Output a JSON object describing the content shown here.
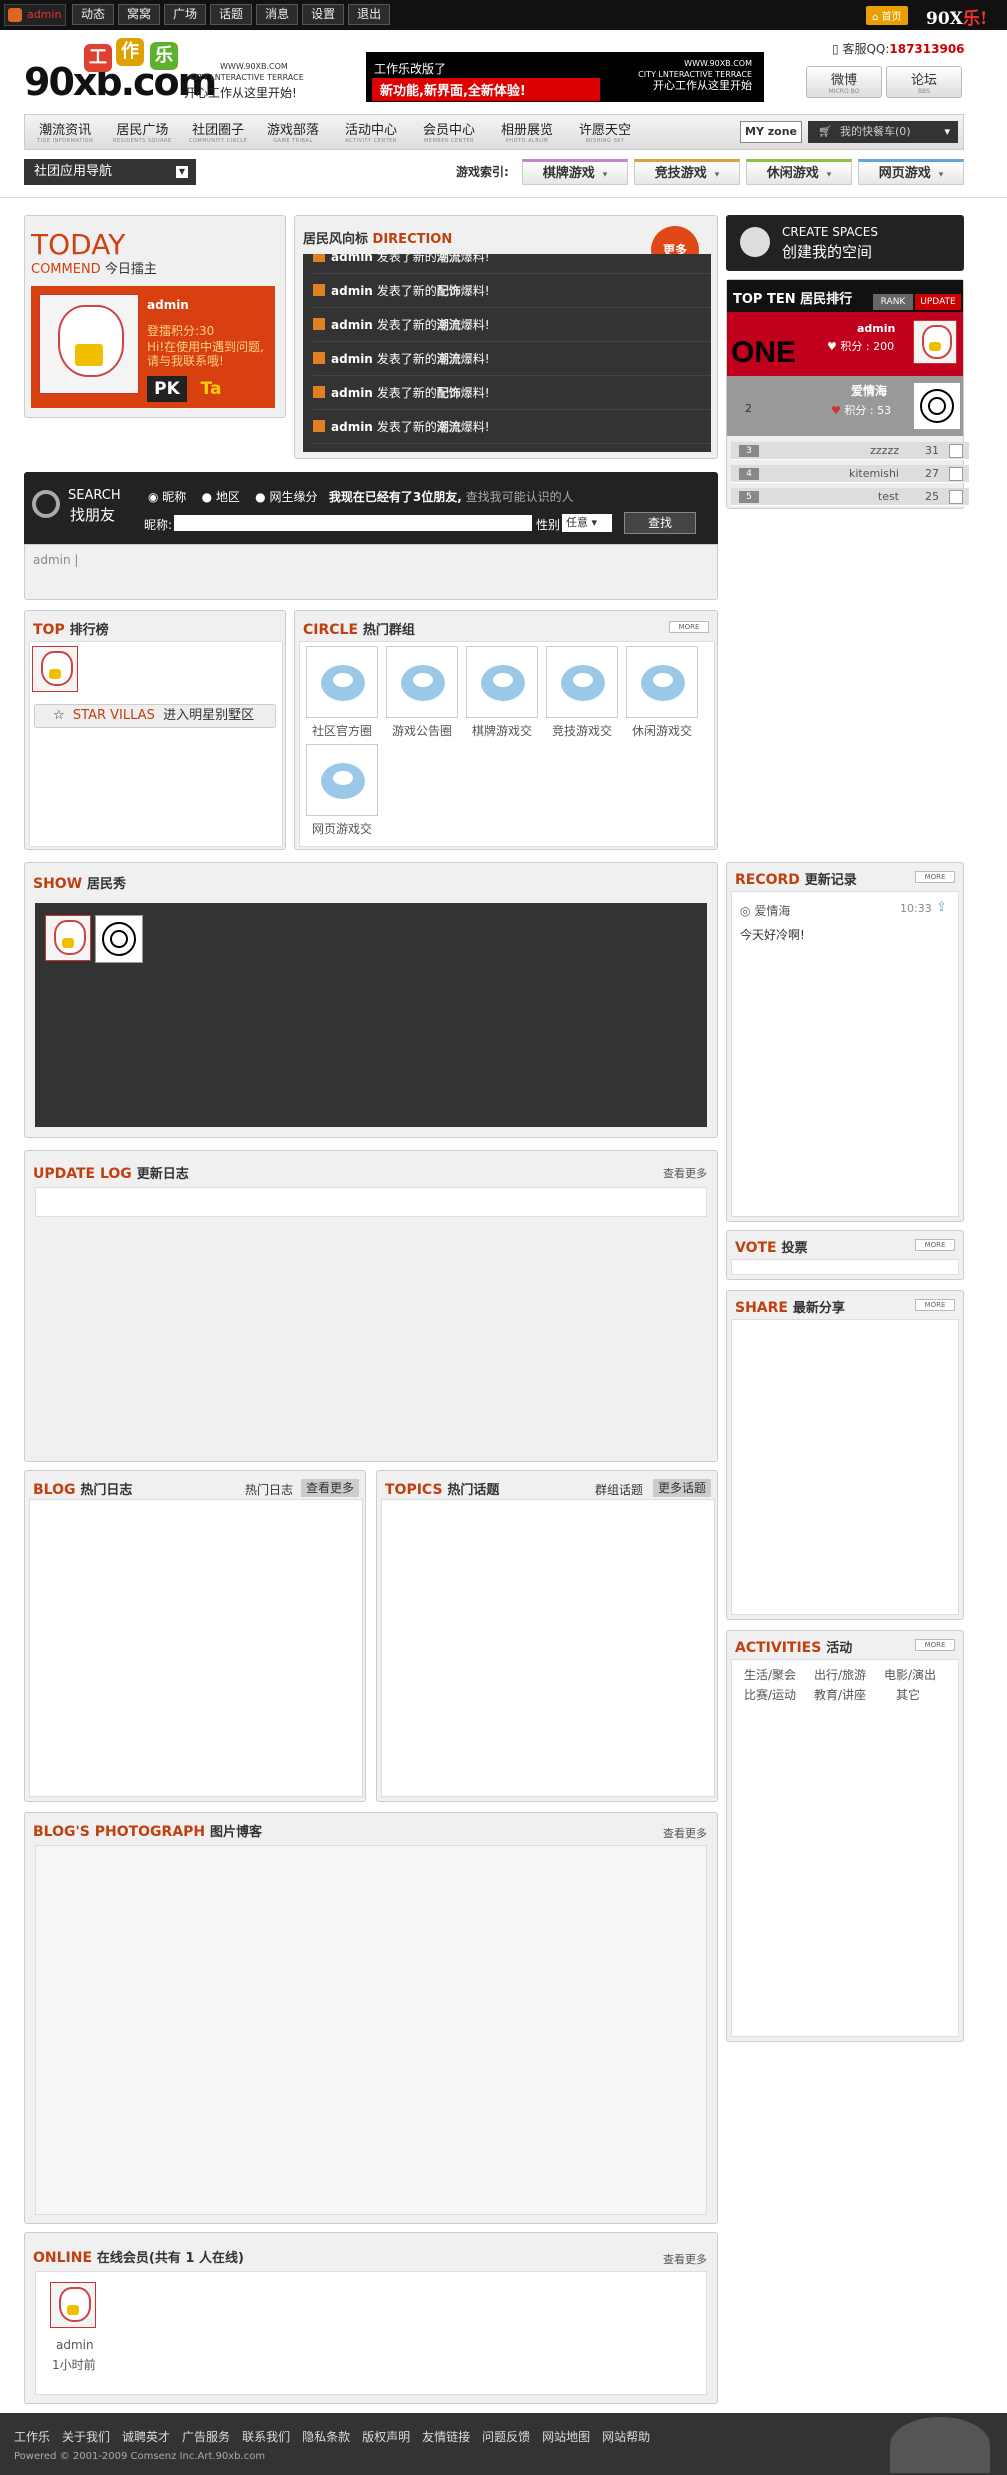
{
  "topbar": {
    "user": "admin",
    "nav": [
      "动态",
      "窝窝",
      "广场",
      "话题",
      "消息",
      "设置",
      "退出"
    ],
    "home_label": "首页",
    "brand": "90X",
    "brand_suffix": "乐!"
  },
  "header": {
    "logo_text": "90xb.com",
    "logo_chars": [
      "工",
      "作",
      "乐"
    ],
    "site_url": "WWW.90XB.COM",
    "slogan_en": "CITY LNTERACTIVE TERRACE",
    "slogan_cn": "开心工作从这里开始!",
    "banner_top": "工作乐改版了",
    "banner_main": "新功能,新界面,全新体验!",
    "banner_url": "WWW.90XB.COM",
    "banner_en": "CITY LNTERACTIVE TERRACE",
    "banner_cn": "开心工作从这里开始",
    "qq_label": "客服QQ:",
    "qq_number": "187313906",
    "btn_micro": "微博",
    "btn_micro_sub": "MICRO BO",
    "btn_bbs": "论坛",
    "btn_bbs_sub": "BBS"
  },
  "mainnav": {
    "items": [
      {
        "label": "潮流资讯",
        "sub": "TIDE INFORMATION"
      },
      {
        "label": "居民广场",
        "sub": "RESIDENTS SQUARE"
      },
      {
        "label": "社团圈子",
        "sub": "COMMUNITY CIRCLE"
      },
      {
        "label": "游戏部落",
        "sub": "GAME TRIBAL"
      },
      {
        "label": "活动中心",
        "sub": "ACTIVITY CENTER"
      },
      {
        "label": "会员中心",
        "sub": "MEMBER CENTER"
      },
      {
        "label": "相册展览",
        "sub": "PHOTO ALBUM"
      },
      {
        "label": "许愿天空",
        "sub": "WISHING SKY"
      }
    ],
    "myzone": "MY zone",
    "cart": "我的快餐车(0)"
  },
  "subnav": {
    "app_nav": "社团应用导航",
    "game_index": "游戏索引:",
    "games": [
      "棋牌游戏",
      "竞技游戏",
      "休闲游戏",
      "网页游戏"
    ]
  },
  "today": {
    "title_en": "TODAY",
    "sub_en": "COMMEND",
    "sub_cn": "今日擂主",
    "user": "admin",
    "points": "登擂积分:30",
    "msg1": "Hi!在使用中遇到问题,",
    "msg2": "请与我联系哦!",
    "pk": "PK",
    "ta": "Ta"
  },
  "direction": {
    "title_cn": "居民风向标",
    "title_en": "DIRECTION",
    "more": "更多",
    "rows": [
      {
        "user": "admin",
        "text": "发表了新的",
        "tag": "潮流",
        "suffix": "爆料!"
      },
      {
        "user": "admin",
        "text": "发表了新的",
        "tag": "配饰",
        "suffix": "爆料!"
      },
      {
        "user": "admin",
        "text": "发表了新的",
        "tag": "潮流",
        "suffix": "爆料!"
      },
      {
        "user": "admin",
        "text": "发表了新的",
        "tag": "潮流",
        "suffix": "爆料!"
      },
      {
        "user": "admin",
        "text": "发表了新的",
        "tag": "配饰",
        "suffix": "爆料!"
      },
      {
        "user": "admin",
        "text": "发表了新的",
        "tag": "潮流",
        "suffix": "爆料!"
      }
    ]
  },
  "create_space": {
    "en": "CREATE SPACES",
    "cn": "创建我的空间"
  },
  "topten": {
    "title": "TOP TEN 居民排行",
    "tab_rank": "RANK",
    "tab_update": "UPDATE",
    "one": "ONE",
    "first_name": "admin",
    "first_score": "积分 : 200",
    "second_num": "2",
    "second_name": "爱情海",
    "second_score": "积分 : 53",
    "rows": [
      {
        "n": "3",
        "name": "zzzzz",
        "score": "31"
      },
      {
        "n": "4",
        "name": "kitemishi",
        "score": "27"
      },
      {
        "n": "5",
        "name": "test",
        "score": "25"
      }
    ]
  },
  "search": {
    "en": "SEARCH",
    "cn": "找朋友",
    "opt1": "昵称",
    "opt2": "地区",
    "opt3": "网生缘分",
    "info": "我现在已经有了3位朋友,",
    "info2": "查找我可能认识的人",
    "name_label": "昵称:",
    "sex_label": "性别",
    "sex_value": "任意",
    "btn": "查找",
    "footer": "admin |"
  },
  "top_rank": {
    "en": "TOP",
    "cn": "排行榜",
    "star": "STAR VILLAS",
    "star_cn": "进入明星别墅区"
  },
  "circle": {
    "en": "CIRCLE",
    "cn": "热门群组",
    "more": "MORE",
    "groups": [
      "社区官方圈",
      "游戏公告圈",
      "棋牌游戏交",
      "竞技游戏交",
      "休闲游戏交",
      "网页游戏交"
    ]
  },
  "show": {
    "en": "SHOW",
    "cn": "居民秀"
  },
  "record": {
    "en": "RECORD",
    "cn": "更新记录",
    "more": "MORE",
    "user": "爱情海",
    "time": "10:33",
    "text": "今天好冷啊!"
  },
  "updatelog": {
    "en": "UPDATE LOG",
    "cn": "更新日志",
    "more": "查看更多"
  },
  "vote": {
    "en": "VOTE",
    "cn": "投票",
    "more": "MORE"
  },
  "share": {
    "en": "SHARE",
    "cn": "最新分享",
    "more": "MORE"
  },
  "blog": {
    "en": "BLOG",
    "cn": "热门日志",
    "tab1": "热门日志",
    "tab2": "查看更多"
  },
  "topics": {
    "en": "TOPICS",
    "cn": "热门话题",
    "tab1": "群组话题",
    "tab2": "更多话题"
  },
  "activities": {
    "en": "ACTIVITIES",
    "cn": "活动",
    "more": "MORE",
    "items": [
      "生活/聚会",
      "出行/旅游",
      "电影/演出",
      "比赛/运动",
      "教育/讲座",
      "其它"
    ]
  },
  "photo": {
    "en": "BLOG'S PHOTOGRAPH",
    "cn": "图片博客",
    "more": "查看更多"
  },
  "online": {
    "en": "ONLINE",
    "cn": "在线会员(共有 1 人在线)",
    "more": "查看更多",
    "user": "admin",
    "time": "1小时前"
  },
  "footer": {
    "links": [
      "工作乐",
      "关于我们",
      "诚聘英才",
      "广告服务",
      "联系我们",
      "隐私条款",
      "版权声明",
      "友情链接",
      "问题反馈",
      "网站地图",
      "网站帮助"
    ],
    "copyright": "Powered © 2001-2009 Comsenz Inc.Art.90xb.com"
  }
}
